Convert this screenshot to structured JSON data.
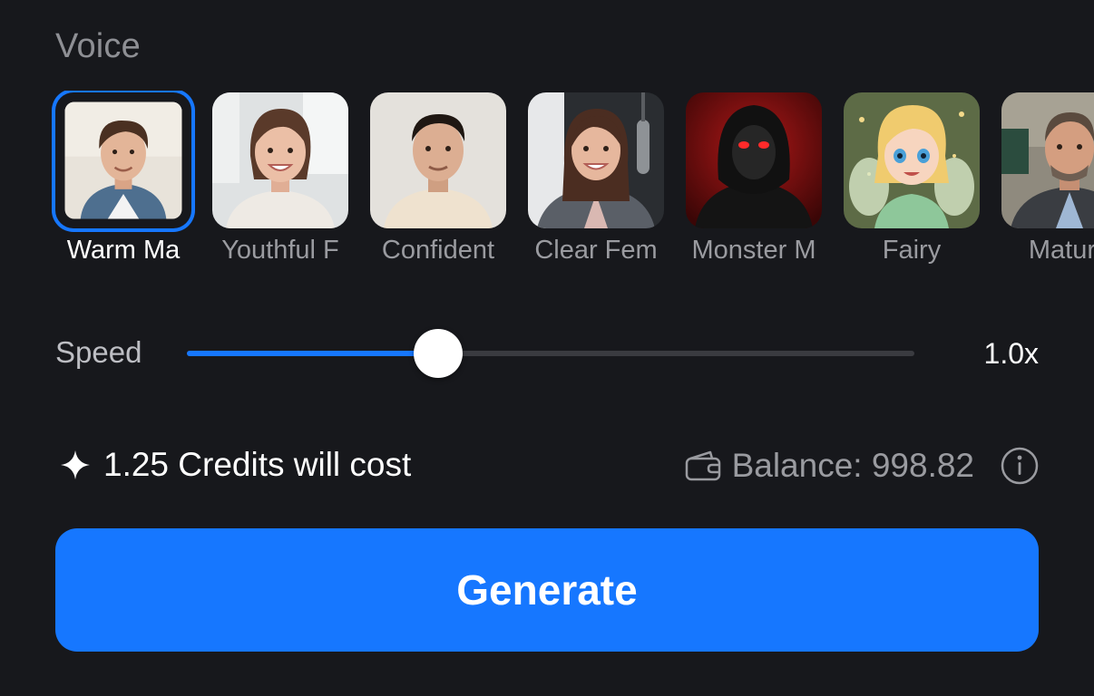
{
  "section_title": "Voice",
  "voices": [
    {
      "label": "Warm Ma",
      "selected": true,
      "icon": "avatar-warm-male"
    },
    {
      "label": "Youthful F",
      "selected": false,
      "icon": "avatar-youthful-female"
    },
    {
      "label": "Confident",
      "selected": false,
      "icon": "avatar-confident-male"
    },
    {
      "label": "Clear Fem",
      "selected": false,
      "icon": "avatar-clear-female"
    },
    {
      "label": "Monster M",
      "selected": false,
      "icon": "avatar-monster"
    },
    {
      "label": "Fairy",
      "selected": false,
      "icon": "avatar-fairy"
    },
    {
      "label": "Mature",
      "selected": false,
      "icon": "avatar-mature-male"
    }
  ],
  "speed": {
    "label": "Speed",
    "value_text": "1.0x",
    "slider_fraction": 0.345
  },
  "cost": {
    "text": "1.25 Credits will cost",
    "icon": "sparkle-icon"
  },
  "balance": {
    "text": "Balance: 998.82",
    "icon": "wallet-icon",
    "info_icon": "info-icon"
  },
  "generate_label": "Generate",
  "colors": {
    "background": "#17181c",
    "accent": "#1677ff",
    "muted_text": "#9a9ba0"
  }
}
